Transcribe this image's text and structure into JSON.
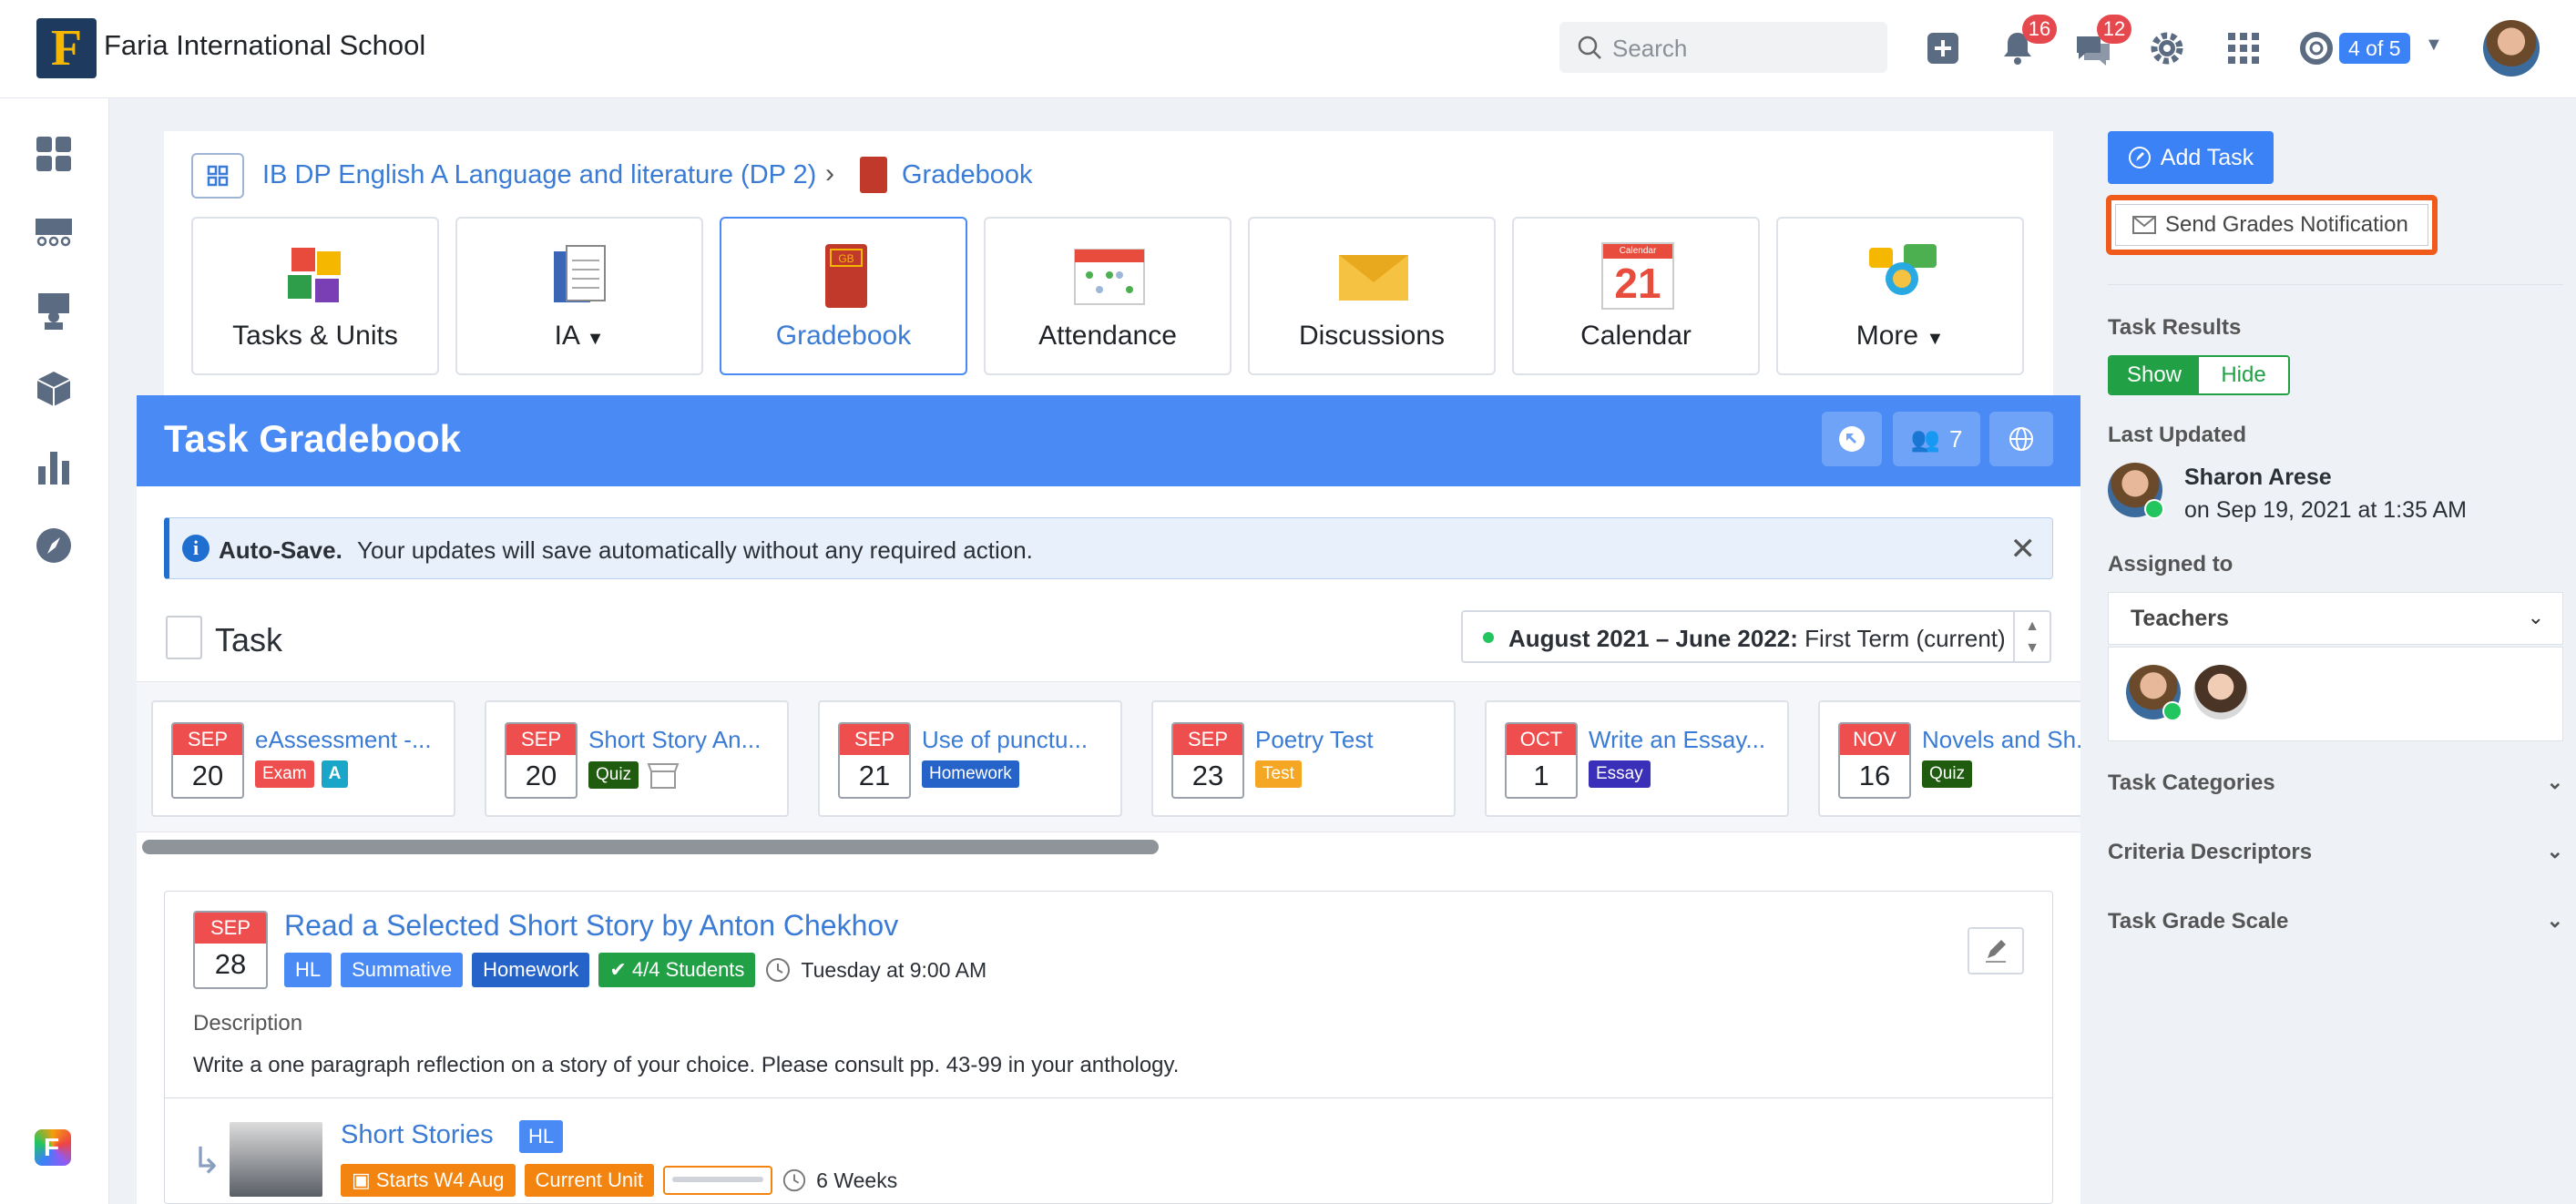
{
  "app": {
    "school_name": "Faria International School",
    "logo_letter": "F"
  },
  "topbar": {
    "search_placeholder": "Search",
    "notifications_count": "16",
    "messages_count": "12",
    "user_switch_label": "4 of 5"
  },
  "breadcrumb": {
    "course": "IB DP English A Language and literature (DP 2)",
    "separator": "›",
    "current": "Gradebook"
  },
  "tiles": [
    {
      "label": "Tasks & Units"
    },
    {
      "label": "IA",
      "dropdown": true
    },
    {
      "label": "Gradebook",
      "active": true
    },
    {
      "label": "Attendance"
    },
    {
      "label": "Discussions"
    },
    {
      "label": "Calendar",
      "calendar_day": "21",
      "calendar_header": "Calendar"
    },
    {
      "label": "More",
      "dropdown": true
    }
  ],
  "gradebook": {
    "title": "Task Gradebook",
    "students_count": "7",
    "autosave_title": "Auto-Save.",
    "autosave_text": "Your updates will save automatically without any required action.",
    "autosave_close": "✕",
    "task_label": "Task",
    "term_bold": "August 2021 – June 2022:",
    "term_rest": " First Term (current)"
  },
  "tasks": [
    {
      "month": "SEP",
      "day": "20",
      "name": "eAssessment -...",
      "tag": "Exam",
      "tag_color": "#ef4e4e",
      "extra": "A"
    },
    {
      "month": "SEP",
      "day": "20",
      "name": "Short Story An...",
      "tag": "Quiz",
      "tag_color": "#1f5c0f",
      "extra_icon": "store-icon"
    },
    {
      "month": "SEP",
      "day": "21",
      "name": "Use of punctu...",
      "tag": "Homework",
      "tag_color": "#2563c9"
    },
    {
      "month": "SEP",
      "day": "23",
      "name": "Poetry Test",
      "tag": "Test",
      "tag_color": "#f5a623"
    },
    {
      "month": "OCT",
      "day": "1",
      "name": "Write an Essay...",
      "tag": "Essay",
      "tag_color": "#3a2fb8"
    },
    {
      "month": "NOV",
      "day": "16",
      "name": "Novels and Sh...",
      "tag": "Quiz",
      "tag_color": "#1f5c0f"
    }
  ],
  "detail": {
    "month": "SEP",
    "day": "28",
    "title": "Read a Selected Short Story by Anton Chekhov",
    "tags": [
      {
        "label": "HL",
        "color": "#4a8af4"
      },
      {
        "label": "Summative",
        "color": "#4a8af4"
      },
      {
        "label": "Homework",
        "color": "#2563c9"
      },
      {
        "label": "4/4 Students",
        "color": "#22a046"
      }
    ],
    "time": "Tuesday at 9:00 AM",
    "description_label": "Description",
    "description": "Write a one paragraph reflection on a story of your choice. Please consult pp. 43-99 in your anthology."
  },
  "unit": {
    "name": "Short Stories",
    "level": "HL",
    "starts": "Starts W4 Aug",
    "status": "Current Unit",
    "duration": "6 Weeks"
  },
  "right": {
    "add_task": "Add Task",
    "send_grades": "Send Grades Notification",
    "task_results": "Task Results",
    "show": "Show",
    "hide": "Hide",
    "last_updated": "Last Updated",
    "updated_by": "Sharon Arese",
    "updated_on": "on Sep 19, 2021 at 1:35 AM",
    "assigned_to": "Assigned to",
    "teachers": "Teachers",
    "sections": [
      "Task Categories",
      "Criteria Descriptors",
      "Task Grade Scale"
    ]
  },
  "colors": {
    "accent": "#4a8af4",
    "highlight_border": "#f05a1a",
    "success": "#22a046"
  }
}
